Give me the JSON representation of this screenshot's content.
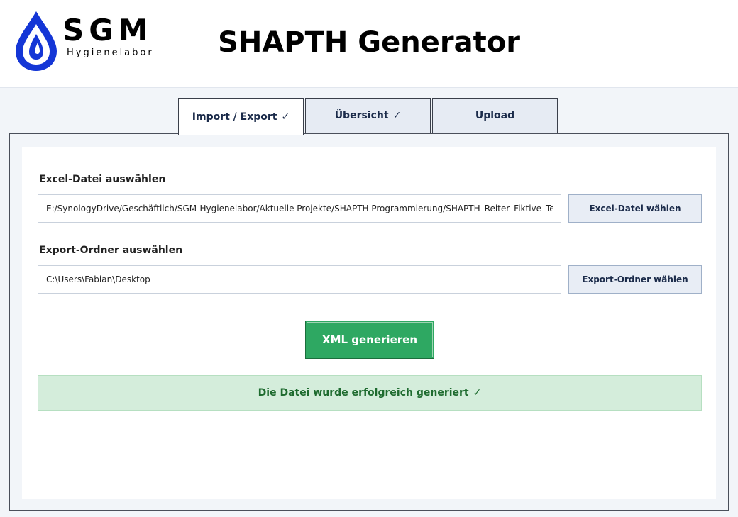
{
  "header": {
    "logo_text": "SGM",
    "logo_subtext": "Hygienelabor",
    "title": "SHAPTH Generator"
  },
  "tabs": [
    {
      "label": "Import / Export",
      "check": "✓",
      "active": true
    },
    {
      "label": "Übersicht",
      "check": "✓",
      "active": false
    },
    {
      "label": "Upload",
      "check": "",
      "active": false
    }
  ],
  "excel": {
    "label": "Excel-Datei auswählen",
    "value": "E:/SynologyDrive/Geschäftlich/SGM-Hygienelabor/Aktuelle Projekte/SHAPTH Programmierung/SHAPTH_Reiter_Fiktive_Testdaten.xlsx",
    "button_label": "Excel-Datei wählen"
  },
  "export": {
    "label": "Export-Ordner auswählen",
    "value": "C:\\Users\\Fabian\\Desktop",
    "button_label": "Export-Ordner wählen"
  },
  "generate": {
    "button_label": "XML generieren"
  },
  "status": {
    "message": "Die Datei wurde erfolgreich generiert",
    "check": "✓"
  },
  "colors": {
    "logo_blue": "#1436d6",
    "generate_green": "#2ea862",
    "status_bg": "#d4eddb",
    "status_text": "#1e6b2f"
  },
  "icons": {
    "logo": "water-drop-icon",
    "check": "check-icon"
  }
}
